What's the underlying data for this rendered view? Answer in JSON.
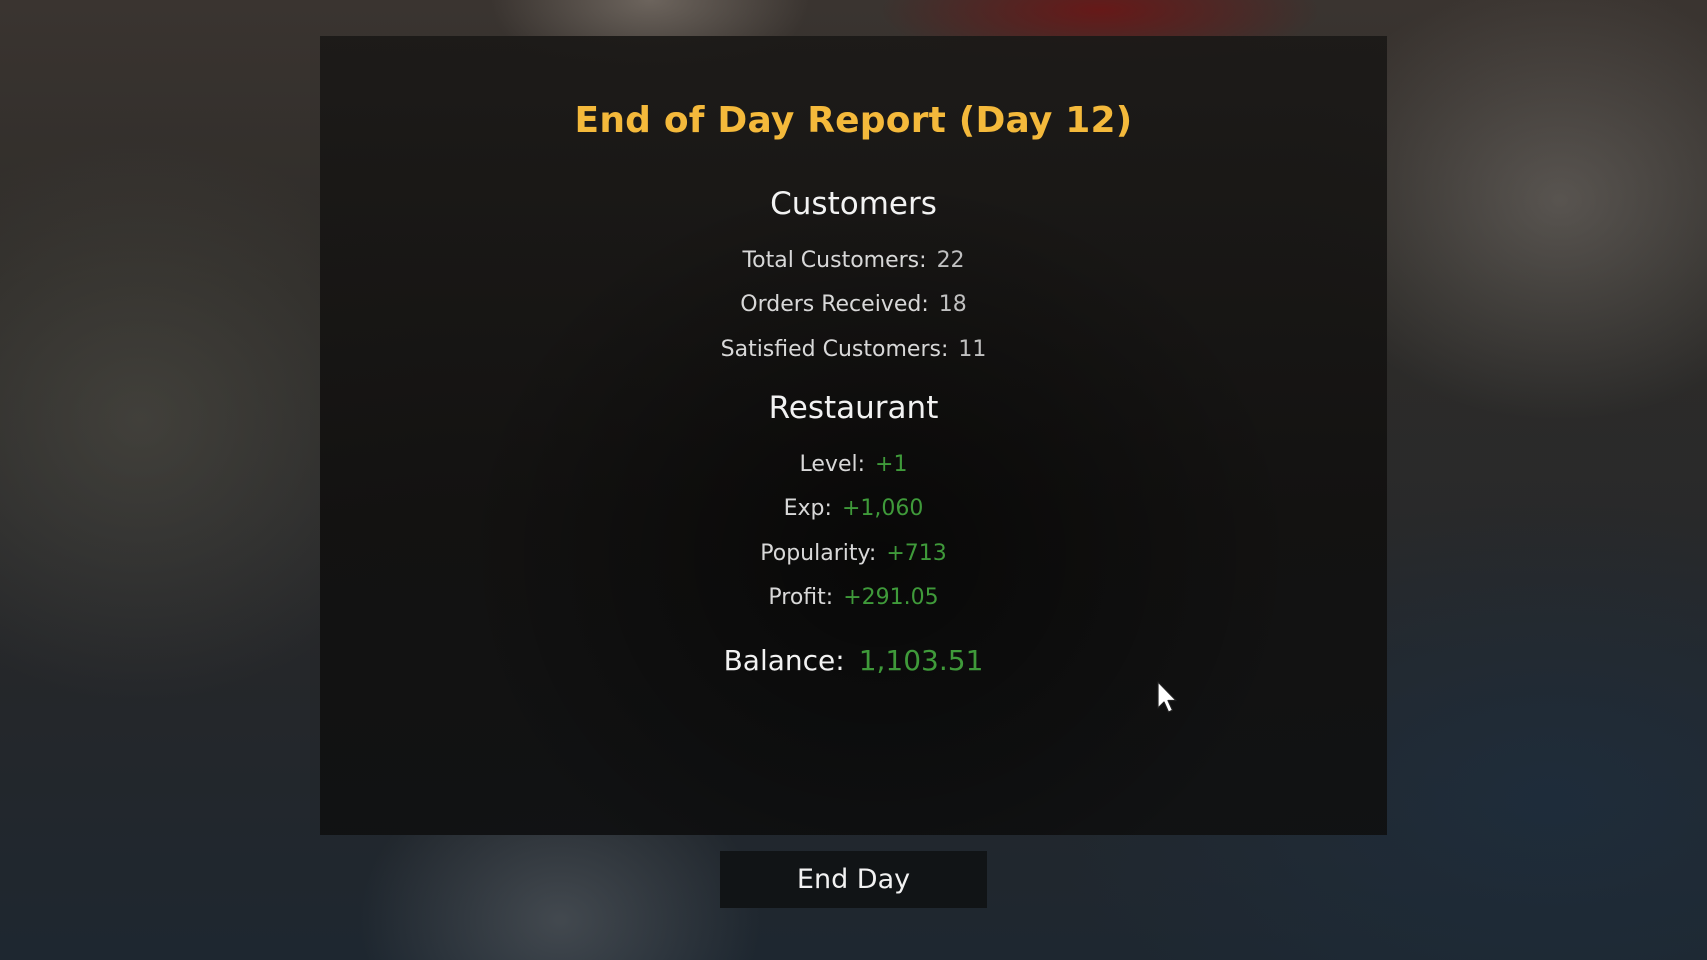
{
  "report": {
    "title": "End of Day Report (Day 12)",
    "customers": {
      "heading": "Customers",
      "rows": [
        {
          "label": "Total Customers:",
          "value": "22"
        },
        {
          "label": "Orders Received:",
          "value": "18"
        },
        {
          "label": "Satisfied Customers:",
          "value": "11"
        }
      ]
    },
    "restaurant": {
      "heading": "Restaurant",
      "rows": [
        {
          "label": "Level:",
          "value": "+1"
        },
        {
          "label": "Exp:",
          "value": "+1,060"
        },
        {
          "label": "Popularity:",
          "value": "+713"
        },
        {
          "label": "Profit:",
          "value": "+291.05"
        }
      ]
    },
    "balance": {
      "label": "Balance:",
      "value": "1,103.51"
    }
  },
  "actions": {
    "end_day_label": "End Day"
  },
  "colors": {
    "title": "#f4b93b",
    "positive": "#3f9a3a",
    "panel": "#1a1816",
    "button": "#111416"
  },
  "icons": {
    "cursor": "mouse-pointer-icon"
  }
}
